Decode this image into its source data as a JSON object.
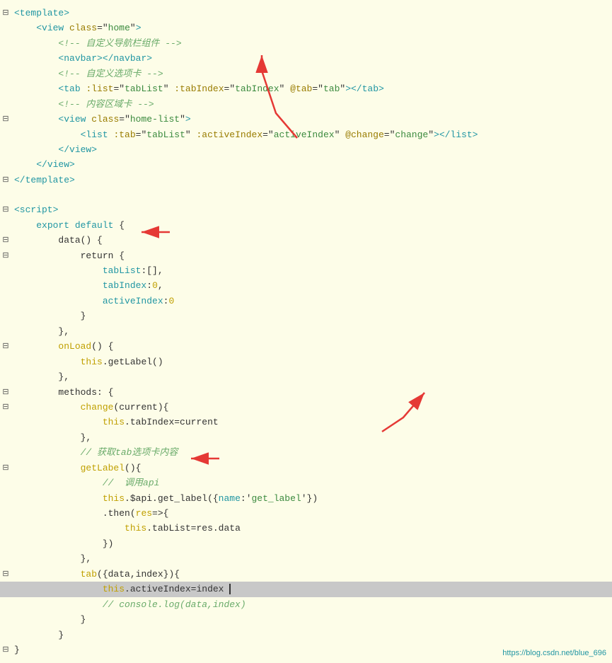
{
  "lines": [
    {
      "id": 1,
      "gutter": "⊟",
      "indent": 0,
      "tokens": [
        {
          "t": "tag",
          "v": "<template>"
        }
      ]
    },
    {
      "id": 2,
      "gutter": "",
      "indent": 1,
      "tokens": [
        {
          "t": "tag",
          "v": "<view"
        },
        {
          "t": "plain",
          "v": " "
        },
        {
          "t": "attr-name",
          "v": "class"
        },
        {
          "t": "plain",
          "v": "=\""
        },
        {
          "t": "attr-value",
          "v": "home"
        },
        {
          "t": "plain",
          "v": "\""
        },
        {
          "t": "tag",
          "v": ">"
        }
      ]
    },
    {
      "id": 3,
      "gutter": "",
      "indent": 2,
      "tokens": [
        {
          "t": "comment",
          "v": "<!-- 自定义导航栏组件 -->"
        }
      ]
    },
    {
      "id": 4,
      "gutter": "",
      "indent": 2,
      "tokens": [
        {
          "t": "tag",
          "v": "<navbar></navbar>"
        }
      ]
    },
    {
      "id": 5,
      "gutter": "",
      "indent": 2,
      "tokens": [
        {
          "t": "comment",
          "v": "<!-- 自定义选项卡 -->"
        }
      ]
    },
    {
      "id": 6,
      "gutter": "",
      "indent": 2,
      "tokens": [
        {
          "t": "tag",
          "v": "<tab"
        },
        {
          "t": "plain",
          "v": " "
        },
        {
          "t": "attr-name",
          "v": ":list"
        },
        {
          "t": "plain",
          "v": "=\""
        },
        {
          "t": "attr-value",
          "v": "tabList"
        },
        {
          "t": "plain",
          "v": "\" "
        },
        {
          "t": "attr-name",
          "v": ":tabIndex"
        },
        {
          "t": "plain",
          "v": "=\""
        },
        {
          "t": "attr-value",
          "v": "tabIndex"
        },
        {
          "t": "plain",
          "v": "\" "
        },
        {
          "t": "attr-name",
          "v": "@tab"
        },
        {
          "t": "plain",
          "v": "=\""
        },
        {
          "t": "attr-value",
          "v": "tab"
        },
        {
          "t": "plain",
          "v": "\""
        },
        {
          "t": "tag",
          "v": "></tab>"
        }
      ]
    },
    {
      "id": 7,
      "gutter": "",
      "indent": 2,
      "tokens": [
        {
          "t": "comment",
          "v": "<!-- 内容区域卡 -->"
        }
      ]
    },
    {
      "id": 8,
      "gutter": "⊟",
      "indent": 2,
      "tokens": [
        {
          "t": "tag",
          "v": "<view"
        },
        {
          "t": "plain",
          "v": " "
        },
        {
          "t": "attr-name",
          "v": "class"
        },
        {
          "t": "plain",
          "v": "=\""
        },
        {
          "t": "attr-value",
          "v": "home-list"
        },
        {
          "t": "plain",
          "v": "\""
        },
        {
          "t": "tag",
          "v": ">"
        }
      ]
    },
    {
      "id": 9,
      "gutter": "",
      "indent": 3,
      "tokens": [
        {
          "t": "tag",
          "v": "<list"
        },
        {
          "t": "plain",
          "v": " "
        },
        {
          "t": "attr-name",
          "v": ":tab"
        },
        {
          "t": "plain",
          "v": "=\""
        },
        {
          "t": "attr-value",
          "v": "tabList"
        },
        {
          "t": "plain",
          "v": "\" "
        },
        {
          "t": "attr-name",
          "v": ":activeIndex"
        },
        {
          "t": "plain",
          "v": "=\""
        },
        {
          "t": "attr-value",
          "v": "activeIndex"
        },
        {
          "t": "plain",
          "v": "\" "
        },
        {
          "t": "attr-name",
          "v": "@change"
        },
        {
          "t": "plain",
          "v": "=\""
        },
        {
          "t": "attr-value",
          "v": "change"
        },
        {
          "t": "plain",
          "v": "\""
        },
        {
          "t": "tag",
          "v": "></list>"
        }
      ]
    },
    {
      "id": 10,
      "gutter": "",
      "indent": 2,
      "tokens": [
        {
          "t": "tag",
          "v": "</view>"
        }
      ]
    },
    {
      "id": 11,
      "gutter": "",
      "indent": 1,
      "tokens": [
        {
          "t": "tag",
          "v": "</view>"
        }
      ]
    },
    {
      "id": 12,
      "gutter": "⊟",
      "indent": 0,
      "tokens": [
        {
          "t": "tag",
          "v": "</template>"
        }
      ]
    },
    {
      "id": 13,
      "gutter": "",
      "indent": 0,
      "tokens": []
    },
    {
      "id": 14,
      "gutter": "⊟",
      "indent": 0,
      "tokens": [
        {
          "t": "tag",
          "v": "<script>"
        }
      ]
    },
    {
      "id": 15,
      "gutter": "",
      "indent": 1,
      "tokens": [
        {
          "t": "keyword",
          "v": "export default"
        },
        {
          "t": "plain",
          "v": " {"
        }
      ]
    },
    {
      "id": 16,
      "gutter": "⊟",
      "indent": 2,
      "tokens": [
        {
          "t": "plain",
          "v": "data() {"
        }
      ]
    },
    {
      "id": 17,
      "gutter": "⊟",
      "indent": 3,
      "tokens": [
        {
          "t": "plain",
          "v": "return {"
        }
      ]
    },
    {
      "id": 18,
      "gutter": "",
      "indent": 4,
      "tokens": [
        {
          "t": "property",
          "v": "tabList"
        },
        {
          "t": "plain",
          "v": ":[],"
        }
      ]
    },
    {
      "id": 19,
      "gutter": "",
      "indent": 4,
      "tokens": [
        {
          "t": "property",
          "v": "tabIndex"
        },
        {
          "t": "plain",
          "v": ":"
        },
        {
          "t": "number",
          "v": "0"
        },
        {
          "t": "plain",
          "v": ","
        }
      ]
    },
    {
      "id": 20,
      "gutter": "",
      "indent": 4,
      "tokens": [
        {
          "t": "property",
          "v": "activeIndex"
        },
        {
          "t": "plain",
          "v": ":"
        },
        {
          "t": "number",
          "v": "0"
        }
      ]
    },
    {
      "id": 21,
      "gutter": "",
      "indent": 3,
      "tokens": [
        {
          "t": "plain",
          "v": "}"
        }
      ]
    },
    {
      "id": 22,
      "gutter": "",
      "indent": 2,
      "tokens": [
        {
          "t": "plain",
          "v": "},"
        }
      ]
    },
    {
      "id": 23,
      "gutter": "⊟",
      "indent": 2,
      "tokens": [
        {
          "t": "method",
          "v": "onLoad"
        },
        {
          "t": "plain",
          "v": "() {"
        }
      ]
    },
    {
      "id": 24,
      "gutter": "",
      "indent": 3,
      "tokens": [
        {
          "t": "this-kw",
          "v": "this"
        },
        {
          "t": "plain",
          "v": ".getLabel()"
        }
      ]
    },
    {
      "id": 25,
      "gutter": "",
      "indent": 2,
      "tokens": [
        {
          "t": "plain",
          "v": "},"
        }
      ]
    },
    {
      "id": 26,
      "gutter": "⊟",
      "indent": 2,
      "tokens": [
        {
          "t": "plain",
          "v": "methods: {"
        }
      ]
    },
    {
      "id": 27,
      "gutter": "⊟",
      "indent": 3,
      "tokens": [
        {
          "t": "method",
          "v": "change"
        },
        {
          "t": "plain",
          "v": "(current){"
        }
      ]
    },
    {
      "id": 28,
      "gutter": "",
      "indent": 4,
      "tokens": [
        {
          "t": "this-kw",
          "v": "this"
        },
        {
          "t": "plain",
          "v": ".tabIndex=current"
        }
      ]
    },
    {
      "id": 29,
      "gutter": "",
      "indent": 3,
      "tokens": [
        {
          "t": "plain",
          "v": "},"
        }
      ]
    },
    {
      "id": 30,
      "gutter": "",
      "indent": 3,
      "tokens": [
        {
          "t": "comment",
          "v": "// 获取tab选项卡内容"
        }
      ]
    },
    {
      "id": 31,
      "gutter": "⊟",
      "indent": 3,
      "tokens": [
        {
          "t": "method",
          "v": "getLabel"
        },
        {
          "t": "plain",
          "v": "(){"
        }
      ]
    },
    {
      "id": 32,
      "gutter": "",
      "indent": 4,
      "tokens": [
        {
          "t": "comment",
          "v": "//  调用api"
        }
      ]
    },
    {
      "id": 33,
      "gutter": "",
      "indent": 4,
      "tokens": [
        {
          "t": "this-kw",
          "v": "this"
        },
        {
          "t": "plain",
          "v": ".$api.get_label({"
        },
        {
          "t": "property",
          "v": "name"
        },
        {
          "t": "plain",
          "v": ":'"
        },
        {
          "t": "string",
          "v": "get_label"
        },
        {
          "t": "plain",
          "v": "'})"
        }
      ]
    },
    {
      "id": 34,
      "gutter": "",
      "indent": 4,
      "tokens": [
        {
          "t": "plain",
          "v": ".then("
        },
        {
          "t": "method",
          "v": "res"
        },
        {
          "t": "plain",
          "v": "=>{"
        }
      ]
    },
    {
      "id": 35,
      "gutter": "",
      "indent": 5,
      "tokens": [
        {
          "t": "this-kw",
          "v": "this"
        },
        {
          "t": "plain",
          "v": ".tabList=res.data"
        }
      ]
    },
    {
      "id": 36,
      "gutter": "",
      "indent": 4,
      "tokens": [
        {
          "t": "plain",
          "v": "})"
        }
      ]
    },
    {
      "id": 37,
      "gutter": "",
      "indent": 3,
      "tokens": [
        {
          "t": "plain",
          "v": "},"
        }
      ]
    },
    {
      "id": 38,
      "gutter": "⊟",
      "indent": 3,
      "tokens": [
        {
          "t": "method",
          "v": "tab"
        },
        {
          "t": "plain",
          "v": "({data,index}){"
        }
      ]
    },
    {
      "id": 39,
      "gutter": "",
      "indent": 4,
      "tokens": [
        {
          "t": "this-kw",
          "v": "this"
        },
        {
          "t": "plain",
          "v": ".activeIndex=index"
        },
        {
          "t": "cursor",
          "v": ""
        }
      ],
      "highlighted": true
    },
    {
      "id": 40,
      "gutter": "",
      "indent": 4,
      "tokens": [
        {
          "t": "comment",
          "v": "// console.log(data,index)"
        }
      ]
    },
    {
      "id": 41,
      "gutter": "",
      "indent": 3,
      "tokens": [
        {
          "t": "plain",
          "v": "}"
        }
      ]
    },
    {
      "id": 42,
      "gutter": "",
      "indent": 2,
      "tokens": [
        {
          "t": "plain",
          "v": "}"
        }
      ]
    },
    {
      "id": 43,
      "gutter": "⊟",
      "indent": 0,
      "tokens": [
        {
          "t": "plain",
          "v": "}"
        }
      ]
    }
  ],
  "watermark": "https://blog.csdn.net/blue_696"
}
